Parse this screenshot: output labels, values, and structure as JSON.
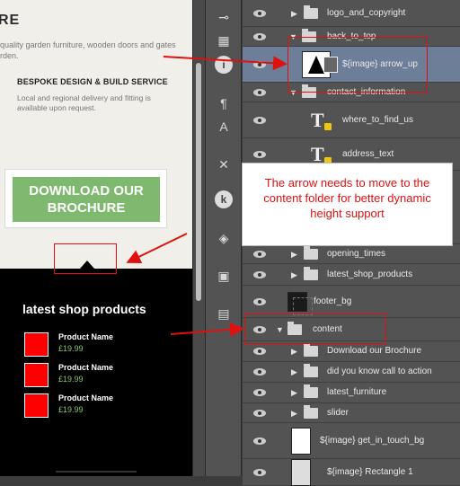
{
  "website": {
    "heading_partial": "RE",
    "intro_text": "quality garden furniture, wooden doors and gates rden.",
    "bespoke_title": "BESPOKE DESIGN & BUILD SERVICE",
    "bespoke_text": "Local and regional delivery and fitting is available upon request.",
    "brochure_button": "DOWNLOAD OUR BROCHURE",
    "shop_title": "latest shop products",
    "products": [
      {
        "name": "Product Name",
        "price": "£19.99"
      },
      {
        "name": "Product Name",
        "price": "£19.99"
      },
      {
        "name": "Product Name",
        "price": "£19.99"
      }
    ]
  },
  "toolbar": {
    "icons": [
      "brush-icon",
      "cube-icon",
      "info-icon",
      "paragraph-icon",
      "character-icon",
      "tools-icon",
      "kuler-icon",
      "3d-icon",
      "layer-comps-icon",
      "brush-preset-icon"
    ]
  },
  "layers": [
    {
      "label": "logo_and_copyright",
      "kind": "folder",
      "level": 1,
      "expanded": false
    },
    {
      "label": "back_to_top",
      "kind": "folder",
      "level": 1,
      "expanded": true
    },
    {
      "label": "${image} arrow_up",
      "kind": "image",
      "level": 2,
      "selected": true
    },
    {
      "label": "contact_information",
      "kind": "folder",
      "level": 1,
      "expanded": true
    },
    {
      "label": "where_to_find_us",
      "kind": "text",
      "level": 2
    },
    {
      "label": "address_text",
      "kind": "text",
      "level": 2
    },
    {
      "label": "opening_times",
      "kind": "folder",
      "level": 1,
      "expanded": false
    },
    {
      "label": "latest_shop_products",
      "kind": "folder",
      "level": 1,
      "expanded": false
    },
    {
      "label": "footer_bg",
      "kind": "image",
      "level": 0
    },
    {
      "label": "content",
      "kind": "folder",
      "level": 0,
      "expanded": true
    },
    {
      "label": "Download our Brochure",
      "kind": "folder",
      "level": 1,
      "expanded": false
    },
    {
      "label": "did you know call to action",
      "kind": "folder",
      "level": 1,
      "expanded": false
    },
    {
      "label": "latest_furniture",
      "kind": "folder",
      "level": 1,
      "expanded": false
    },
    {
      "label": "slider",
      "kind": "folder",
      "level": 1,
      "expanded": false
    },
    {
      "label": "${image} get_in_touch_bg",
      "kind": "image",
      "level": 1
    },
    {
      "label": "${image} Rectangle 1",
      "kind": "image",
      "level": 1
    }
  ],
  "annotation": {
    "note": "The arrow needs to move to the content folder for better dynamic height support",
    "color": "#e01010"
  },
  "colors": {
    "panel": "#535353",
    "selected_row": "#6c7e98",
    "brochure_green": "#7fb96f",
    "price_green": "#8fc26a",
    "product_thumb": "#ff0000"
  }
}
